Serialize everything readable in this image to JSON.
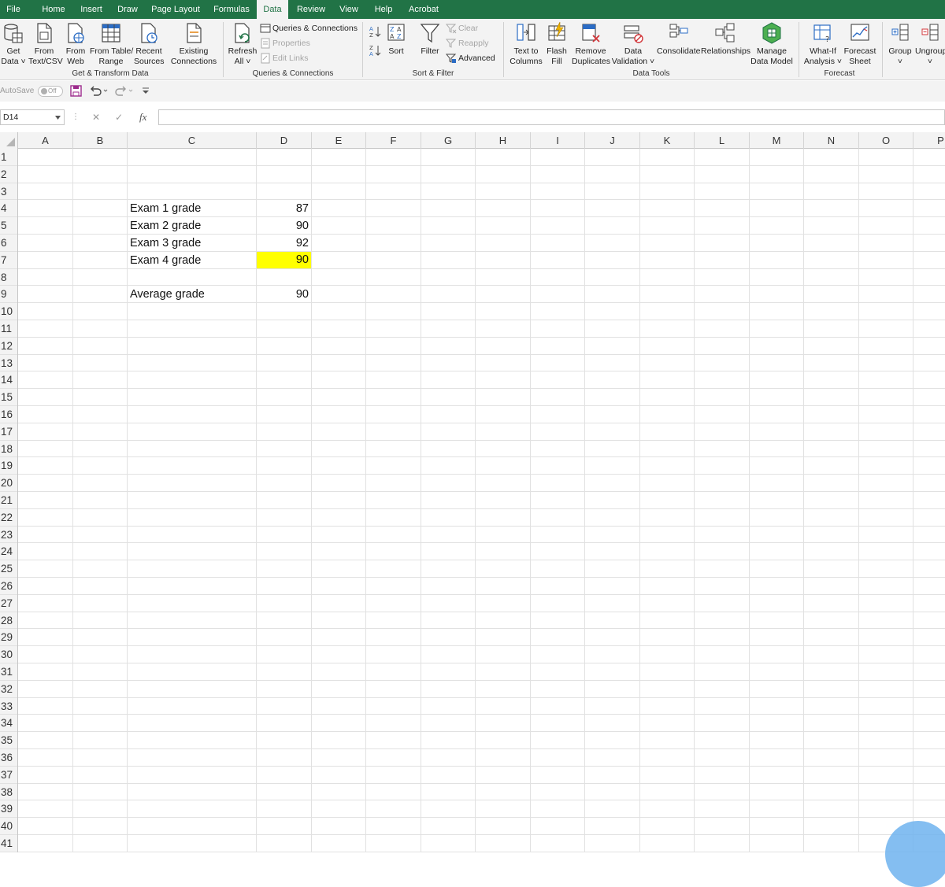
{
  "menu": {
    "file": "File",
    "home": "Home",
    "insert": "Insert",
    "draw": "Draw",
    "page_layout": "Page Layout",
    "formulas": "Formulas",
    "data": "Data",
    "review": "Review",
    "view": "View",
    "help": "Help",
    "acrobat": "Acrobat"
  },
  "ribbon": {
    "get_data": [
      "Get",
      "Data ˅"
    ],
    "from_text_csv": [
      "From",
      "Text/CSV"
    ],
    "from_web": [
      "From",
      "Web"
    ],
    "from_table_range": [
      "From Table/",
      "Range"
    ],
    "recent_sources": [
      "Recent",
      "Sources"
    ],
    "existing_connections": [
      "Existing",
      "Connections"
    ],
    "group_get_transform": "Get & Transform Data",
    "refresh_all": [
      "Refresh",
      "All ˅"
    ],
    "queries_connections": "Queries & Connections",
    "properties": "Properties",
    "edit_links": "Edit Links",
    "group_queries": "Queries & Connections",
    "sort": "Sort",
    "filter": "Filter",
    "clear": "Clear",
    "reapply": "Reapply",
    "advanced": "Advanced",
    "group_sort_filter": "Sort & Filter",
    "text_to_columns": [
      "Text to",
      "Columns"
    ],
    "flash_fill": [
      "Flash",
      "Fill"
    ],
    "remove_duplicates": [
      "Remove",
      "Duplicates"
    ],
    "data_validation": [
      "Data",
      "Validation ˅"
    ],
    "consolidate": "Consolidate",
    "relationships": "Relationships",
    "manage_data_model": [
      "Manage",
      "Data Model"
    ],
    "group_data_tools": "Data Tools",
    "what_if": [
      "What-If",
      "Analysis ˅"
    ],
    "forecast_sheet": [
      "Forecast",
      "Sheet"
    ],
    "group_forecast": "Forecast",
    "group": [
      "Group",
      "˅"
    ],
    "ungroup": [
      "Ungroup",
      "˅"
    ]
  },
  "qat": {
    "autosave": "AutoSave",
    "toggle": "Off"
  },
  "formula_bar": {
    "name_box": "D14",
    "fx": "fx",
    "value": ""
  },
  "columns": [
    "A",
    "B",
    "C",
    "D",
    "E",
    "F",
    "G",
    "H",
    "I",
    "J",
    "K",
    "L",
    "M",
    "N",
    "O",
    "P"
  ],
  "rows": [
    "1",
    "2",
    "3",
    "4",
    "5",
    "6",
    "7",
    "8",
    "9",
    "10",
    "11",
    "12",
    "13",
    "14",
    "15",
    "16",
    "17",
    "18",
    "19",
    "20",
    "21",
    "22",
    "23",
    "24",
    "25",
    "26",
    "27",
    "28",
    "29",
    "30",
    "31",
    "32",
    "33",
    "34",
    "35",
    "36",
    "37",
    "38",
    "39",
    "40",
    "41"
  ],
  "sheet": {
    "c4": "Exam 1 grade",
    "d4": "87",
    "c5": "Exam 2 grade",
    "d5": "90",
    "c6": "Exam 3 grade",
    "d6": "92",
    "c7": "Exam 4 grade",
    "d7": "90",
    "c9": "Average grade",
    "d9": "90"
  },
  "colors": {
    "ribbon_green": "#217346",
    "highlight": "#ffff00"
  }
}
